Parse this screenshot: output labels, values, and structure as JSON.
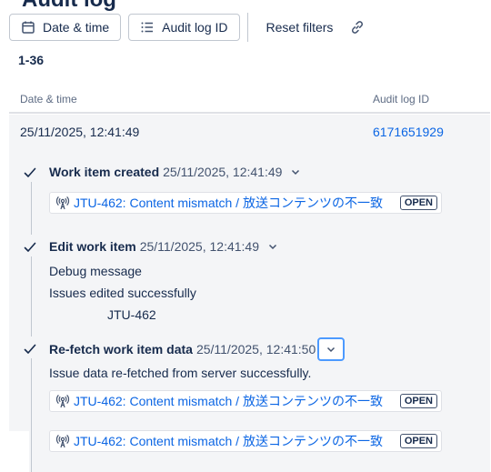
{
  "page": {
    "title": "Audit log"
  },
  "toolbar": {
    "date_filter_label": "Date & time",
    "audit_id_filter_label": "Audit log ID",
    "reset_label": "Reset filters"
  },
  "pagination": {
    "range": "1-36"
  },
  "table": {
    "headers": {
      "date": "Date & time",
      "audit_id": "Audit log ID"
    },
    "row": {
      "date": "25/11/2025, 12:41:49",
      "audit_id": "6171651929"
    }
  },
  "events": [
    {
      "title": "Work item created",
      "time": "25/11/2025, 12:41:49",
      "issue": {
        "text": "JTU-462: Content mismatch / 放送コンテンツの不一致",
        "status": "OPEN"
      }
    },
    {
      "title": "Edit work item",
      "time": "25/11/2025, 12:41:49",
      "messages": [
        "Debug message",
        "Issues edited successfully",
        "JTU-462"
      ]
    },
    {
      "title": "Re-fetch work item data",
      "time": "25/11/2025, 12:41:50",
      "messages": [
        "Issue data re-fetched from server successfully."
      ],
      "issue": {
        "text": "JTU-462: Content mismatch / 放送コンテンツの不一致",
        "status": "OPEN"
      }
    }
  ],
  "extra_issue": {
    "text": "JTU-462: Content mismatch / 放送コンテンツの不一致",
    "status": "OPEN"
  },
  "colors": {
    "link": "#0c66e4",
    "focus_ring": "#4c9aff",
    "row_bg": "#f4f5f7",
    "text": "#172b4d"
  },
  "icons": [
    "calendar-icon",
    "list-icon",
    "link-icon",
    "check-icon",
    "chevron-down-icon",
    "broadcast-icon"
  ]
}
